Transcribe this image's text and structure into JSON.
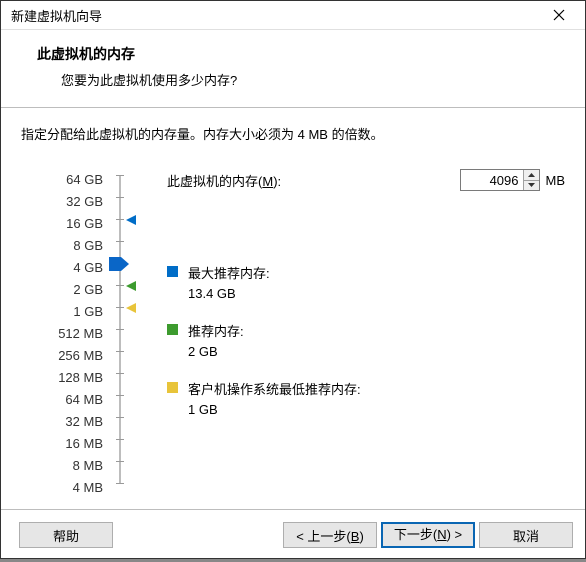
{
  "window": {
    "title": "新建虚拟机向导"
  },
  "header": {
    "title": "此虚拟机的内存",
    "subtitle": "您要为此虚拟机使用多少内存?"
  },
  "instruction": "指定分配给此虚拟机的内存量。内存大小必须为 4 MB 的倍数。",
  "memory": {
    "label_prefix": "此虚拟机的内存(",
    "label_hotkey": "M",
    "label_suffix": "):",
    "value": "4096",
    "unit": "MB"
  },
  "scale": {
    "labels": [
      "64 GB",
      "32 GB",
      "16 GB",
      "8 GB",
      "4 GB",
      "2 GB",
      "1 GB",
      "512 MB",
      "256 MB",
      "128 MB",
      "64 MB",
      "32 MB",
      "16 MB",
      "8 MB",
      "4 MB"
    ]
  },
  "recommendations": {
    "max": {
      "title": "最大推荐内存:",
      "value": "13.4 GB",
      "color": "#006dc7"
    },
    "recommended": {
      "title": "推荐内存:",
      "value": "2 GB",
      "color": "#3d9b2e"
    },
    "min": {
      "title": "客户机操作系统最低推荐内存:",
      "value": "1 GB",
      "color": "#e8c43a"
    }
  },
  "footer": {
    "help": "帮助",
    "back_prefix": "< 上一步(",
    "back_hotkey": "B",
    "back_suffix": ")",
    "next_prefix": "下一步(",
    "next_hotkey": "N",
    "next_suffix": ") >",
    "cancel": "取消"
  }
}
